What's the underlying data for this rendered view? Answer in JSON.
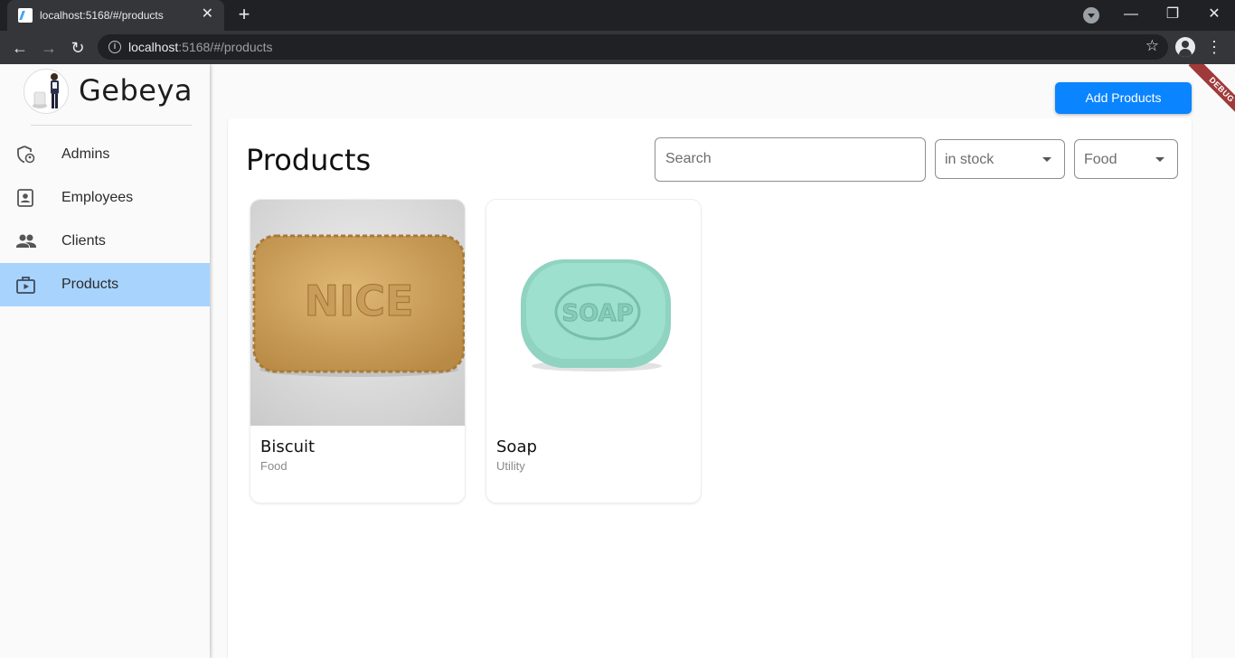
{
  "browser": {
    "tab_title": "localhost:5168/#/products",
    "tab_close": "✕",
    "new_tab": "+",
    "url_host": "localhost",
    "url_path": ":5168/#/products",
    "window_minimize": "—",
    "window_restore": "❐",
    "window_close": "✕",
    "back": "←",
    "forward": "→",
    "reload": "↻",
    "bookmark": "☆",
    "menu": "⋮"
  },
  "sidebar": {
    "brand": "Gebeya",
    "items": [
      {
        "label": "Admins",
        "icon": "admin-shield-icon",
        "active": false
      },
      {
        "label": "Employees",
        "icon": "employee-badge-icon",
        "active": false
      },
      {
        "label": "Clients",
        "icon": "people-icon",
        "active": false
      },
      {
        "label": "Products",
        "icon": "product-box-icon",
        "active": true
      }
    ]
  },
  "header": {
    "add_button": "Add Products",
    "debug_banner": "DEBUG"
  },
  "products_panel": {
    "title": "Products",
    "search_placeholder": "Search",
    "stock_filter": "in stock",
    "category_filter": "Food"
  },
  "products": [
    {
      "name": "Biscuit",
      "category": "Food",
      "image_text": "NICE"
    },
    {
      "name": "Soap",
      "category": "Utility",
      "image_text": "SOAP"
    }
  ],
  "colors": {
    "accent": "#0a84ff",
    "active_nav": "#a8d3fd",
    "debug": "#a03a3a"
  }
}
